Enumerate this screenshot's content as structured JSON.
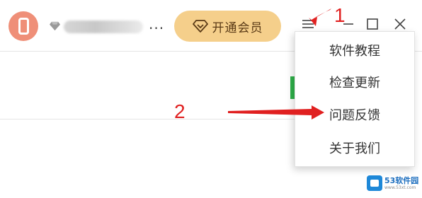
{
  "titlebar": {
    "avatar_icon": "phone-icon",
    "vip_gem_icon": "diamond-icon",
    "ellipsis": "...",
    "vip_button": {
      "label": "开通会员",
      "icon": "diamond-outline-icon"
    },
    "window_controls": [
      "menu-icon",
      "minimize-icon",
      "maximize-icon",
      "close-icon"
    ]
  },
  "menu": {
    "items": [
      {
        "label": "软件教程"
      },
      {
        "label": "检查更新"
      },
      {
        "label": "问题反馈"
      },
      {
        "label": "关于我们"
      }
    ]
  },
  "annotations": {
    "marker_1": "1",
    "marker_2": "2"
  },
  "watermark": {
    "name": "53软件园",
    "url": "www.53xt.com"
  },
  "colors": {
    "avatar": "#ef8f78",
    "vip_button": "#f5cf8b",
    "vip_text": "#5a3a16",
    "annotation_red": "#e02020",
    "green_indicator": "#2fb14a",
    "watermark_blue": "#1e88d8"
  }
}
